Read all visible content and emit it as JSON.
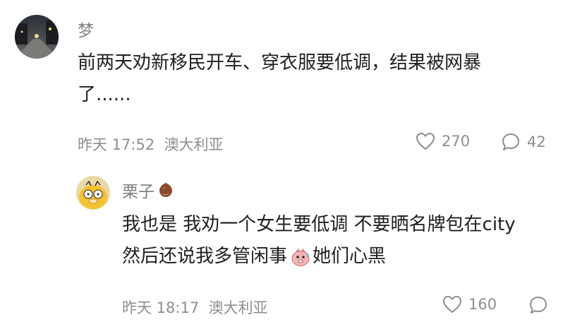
{
  "comments": [
    {
      "username": "梦",
      "content_line1": "前两天劝新移民开车、穿衣服要低调，结果被网暴",
      "content_line2": "了......",
      "time": "昨天 17:52",
      "location": "澳大利亚",
      "likes": "270",
      "replies": "42"
    }
  ],
  "replies": [
    {
      "username": "栗子",
      "content_line1": "我也是 我劝一个女生要低调 不要晒名牌包在city",
      "content_line2_before": "然后还说我多管闲事",
      "content_line2_after": " 她们心黑",
      "time": "昨天 18:17",
      "location": "澳大利亚",
      "likes": "160",
      "icons": {
        "name_badge": "chestnut-emoji",
        "inline": "sweating-face-emoji"
      }
    }
  ]
}
